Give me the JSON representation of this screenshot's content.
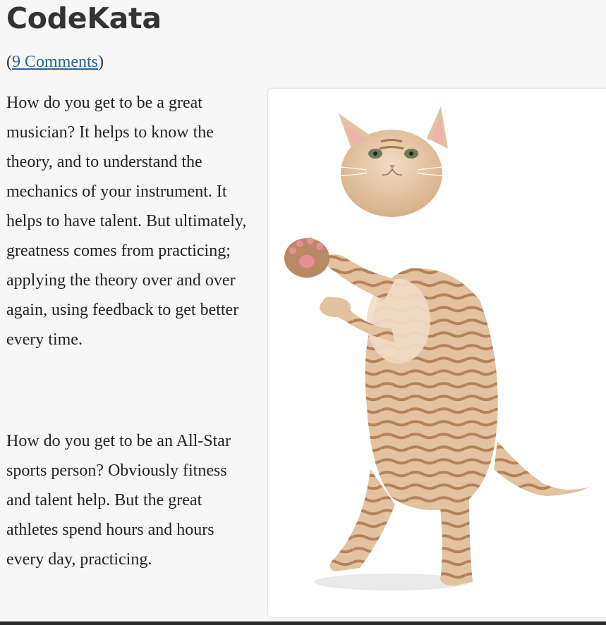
{
  "post": {
    "title": "CodeKata",
    "comments_open": "(",
    "comments_link": "9 Comments",
    "comments_close": ")",
    "paragraphs": [
      "How do you get to be a great musician? It helps to know the theory, and to understand the mechanics of your instrument. It helps to have talent. But ultimately, greatness comes from practicing; applying the theory over and over again, using feedback to get better every time.",
      "How do you get to be an All-Star sports person? Obviously fitness and talent help. But the great athletes spend hours and hours every day, practicing."
    ]
  },
  "image": {
    "subject": "standing-kitten-photo",
    "colors": {
      "fur": "#e3c29f",
      "stripes": "#a9774c",
      "background": "#ffffff"
    }
  },
  "theme": {
    "link_color": "#2a6496",
    "page_background": "#f7f7f7"
  }
}
